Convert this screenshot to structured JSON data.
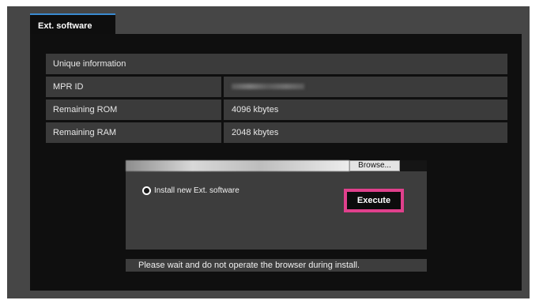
{
  "tab": {
    "label": "Ext. software"
  },
  "info_table": {
    "header": "Unique information",
    "rows": [
      {
        "label": "MPR ID",
        "value": ""
      },
      {
        "label": "Remaining ROM",
        "value": "4096 kbytes"
      },
      {
        "label": "Remaining RAM",
        "value": "2048 kbytes"
      }
    ]
  },
  "install": {
    "file_path": "",
    "browse_label": "Browse...",
    "option_label": "Install new Ext. software",
    "execute_label": "Execute"
  },
  "status": {
    "message": "Please wait and do not operate the browser during install."
  },
  "colors": {
    "highlight": "#e0408c",
    "tab_accent": "#3a8ad0"
  }
}
